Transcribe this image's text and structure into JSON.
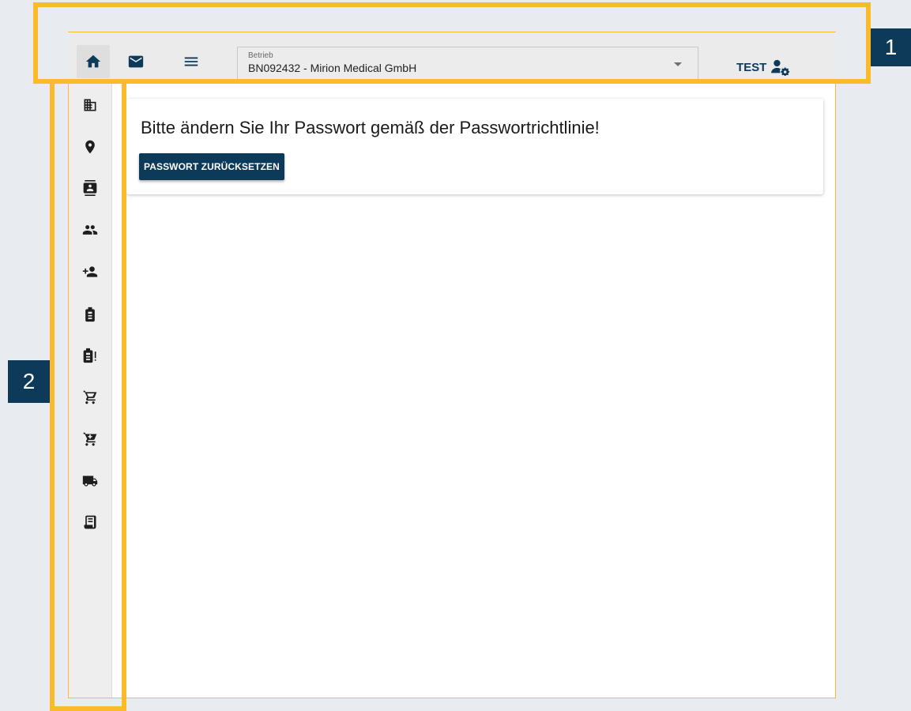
{
  "header": {
    "home_icon": "home-icon",
    "mail_icon": "mail-icon",
    "menu_icon": "menu-icon",
    "betrieb": {
      "label": "Betrieb",
      "value": "BN092432 - Mirion Medical GmbH"
    },
    "user": {
      "name": "TEST",
      "icon": "user-settings-icon"
    }
  },
  "sidebar": {
    "items": [
      {
        "icon": "building-icon"
      },
      {
        "icon": "location-pin-icon"
      },
      {
        "icon": "contacts-icon"
      },
      {
        "icon": "people-icon"
      },
      {
        "icon": "add-person-icon"
      },
      {
        "icon": "dosimeter-icon"
      },
      {
        "icon": "dosimeter-alert-icon"
      },
      {
        "icon": "cart-icon"
      },
      {
        "icon": "cart-add-icon"
      },
      {
        "icon": "truck-icon"
      },
      {
        "icon": "receipt-icon"
      }
    ]
  },
  "main": {
    "message": "Bitte ändern Sie Ihr Passwort gemäß der Passwortrichtlinie!",
    "reset_button": "PASSWORT ZURÜCKSETZEN"
  },
  "callouts": [
    {
      "label": "1"
    },
    {
      "label": "2"
    }
  ],
  "colors": {
    "brand": "#0e3a5a",
    "callout": "#fbb92c",
    "background": "#e8ebef"
  }
}
